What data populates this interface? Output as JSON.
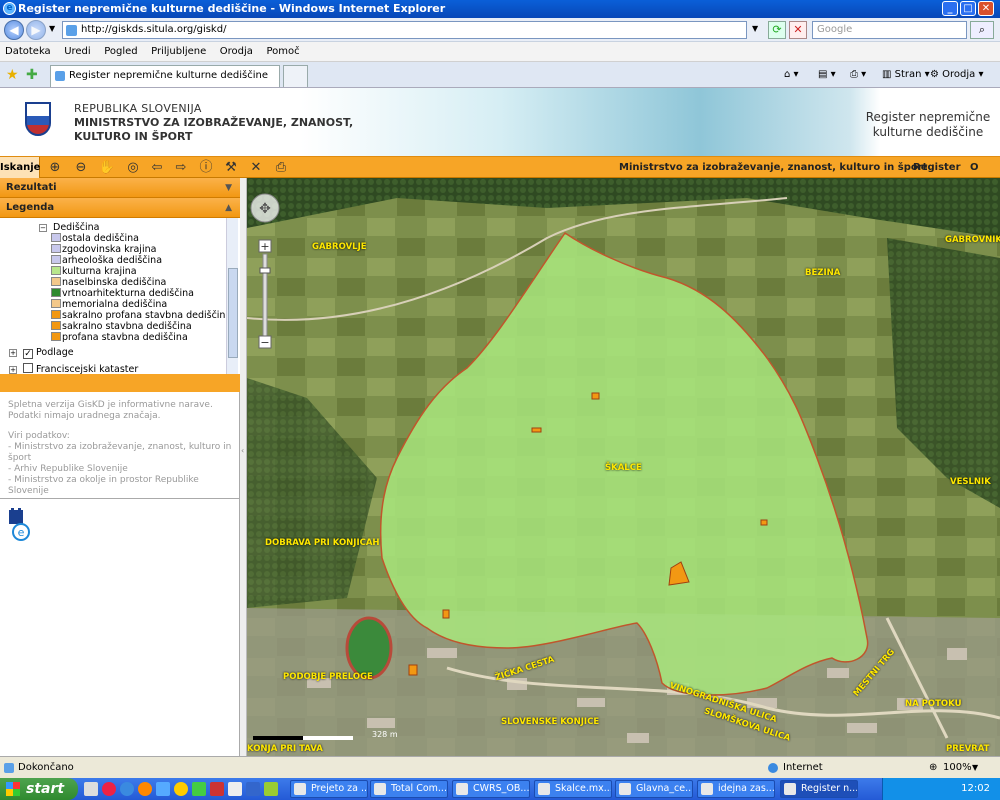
{
  "window": {
    "title": "Register nepremične kulturne dediščine - Windows Internet Explorer",
    "url": "http://giskds.situla.org/giskd/",
    "search_placeholder": "Google",
    "menu": [
      "Datoteka",
      "Uredi",
      "Pogled",
      "Priljubljene",
      "Orodja",
      "Pomoč"
    ],
    "tab_title": "Register nepremične kulturne dediščine",
    "toolbar_right": {
      "page": "Stran",
      "tools": "Orodja"
    }
  },
  "header": {
    "org_line1": "REPUBLIKA SLOVENIJA",
    "org_line2": "MINISTRSTVO ZA IZOBRAŽEVANJE, ZNANOST,",
    "org_line3": "KULTURO IN ŠPORT",
    "app_title_1": "Register nepremične",
    "app_title_2": "kulturne dediščine"
  },
  "toolbar": {
    "search_tab": "Iskanje",
    "links": [
      "Ministrstvo za izobraževanje, znanost, kulturo in šport",
      "Register",
      "O Rkd"
    ]
  },
  "panel": {
    "results_title": "Rezultati",
    "legend_title": "Legenda",
    "heritage_group": "Dediščina",
    "legend_items": [
      {
        "label": "ostala dediščina",
        "color": "#c8c8ec"
      },
      {
        "label": "zgodovinska krajina",
        "color": "#c8c8ec"
      },
      {
        "label": "arheološka dediščina",
        "color": "#c8c8ec"
      },
      {
        "label": "kulturna krajina",
        "color": "#b8e68c"
      },
      {
        "label": "naselbinska dediščina",
        "color": "#f3c88a"
      },
      {
        "label": "vrtnoarhitekturna dediščina",
        "color": "#2f8a2f"
      },
      {
        "label": "memorialna dediščina",
        "color": "#f3c88a"
      },
      {
        "label": "sakralno profana stavbna dediščina",
        "color": "#f29813"
      },
      {
        "label": "sakralno stavbna dediščina",
        "color": "#f29813"
      },
      {
        "label": "profana stavbna dediščina",
        "color": "#f29813"
      }
    ],
    "layer_podlage": "Podlage",
    "layer_kataster": "Franciscejski kataster",
    "info_text": "Spletna verzija GisKD je informativne narave. Podatki nimajo uradnega značaja.",
    "sources_title": "Viri podatkov:",
    "sources": [
      "- Ministrstvo za izobraževanje, znanost, kulturo in šport",
      "- Arhiv Republike Slovenije",
      "- Ministrstvo za okolje in prostor Republike Slovenije"
    ]
  },
  "map": {
    "places": [
      "GABROVLJE",
      "GABROVNIK",
      "BEZINA",
      "ŠKALCE",
      "VESLNIK",
      "DOBRAVA PRI KONJICAH",
      "PODOBJE PRELOGE",
      "SLOVENSKE KONJICE",
      "KONJA PRI TAVA",
      "PREVRAT",
      "NA POTOKU",
      "VINOGRADNIŠKA ULICA",
      "SLOMŠKOVA ULICA",
      "MESTNI TRG",
      "ŽIČKA CESTA"
    ],
    "scale_label": "328 m",
    "polygon_color": "#a8e67c"
  },
  "status": {
    "text": "Dokončano",
    "zone": "Internet",
    "zoom": "100%"
  },
  "taskbar": {
    "start": "start",
    "tasks": [
      "Prejeto za ...",
      "Total Com...",
      "CWRS_OB...",
      "Skalce.mx...",
      "Glavna_ce...",
      "idejna zas...",
      "Register n..."
    ],
    "clock": "12:02"
  }
}
